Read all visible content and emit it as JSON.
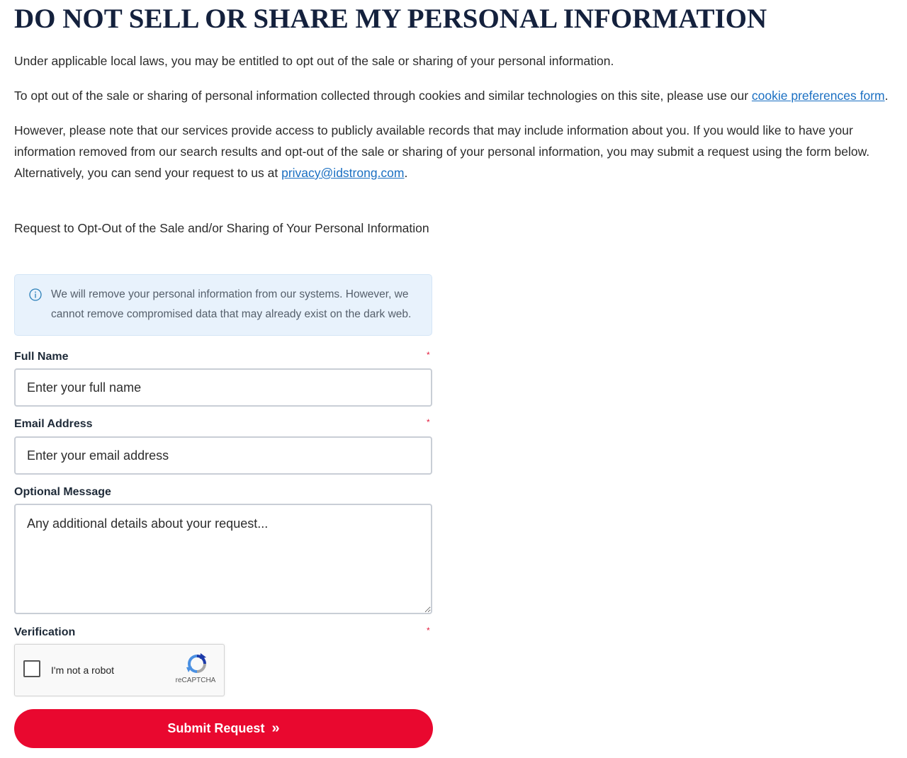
{
  "page": {
    "title": "DO NOT SELL OR SHARE MY PERSONAL INFORMATION",
    "intro": "Under applicable local laws, you may be entitled to opt out of the sale or sharing of your personal information.",
    "cookies_text": "To opt out of the sale or sharing of personal information collected through cookies and similar technologies on this site, please use our ",
    "cookies_link": "cookie preferences form",
    "cookies_end": ".",
    "records_text": "However, please note that our services provide access to publicly available records that may include information about you. If you would like to have your information removed from our search results and opt-out of the sale or sharing of your personal information, you may submit a request using the form below. Alternatively, you can send your request to us at ",
    "email_link": "privacy@idstrong.com",
    "records_end": "."
  },
  "form": {
    "heading": "Request to Opt-Out of the Sale and/or Sharing of Your Personal Information",
    "notice": "We will remove your personal information from our systems. However, we cannot remove compromised data that may already exist on the dark web.",
    "required_mark": "*",
    "full_name": {
      "label": "Full Name",
      "placeholder": "Enter your full name",
      "value": ""
    },
    "email": {
      "label": "Email Address",
      "placeholder": "Enter your email address",
      "value": ""
    },
    "message": {
      "label": "Optional Message",
      "placeholder": "Any additional details about your request...",
      "value": ""
    },
    "verification": {
      "label": "Verification",
      "checkbox_label": "I'm not a robot",
      "brand": "reCAPTCHA",
      "checked": false
    },
    "submit": {
      "label": "Submit Request",
      "icon": "double-chevron-right-icon",
      "chevron_glyph": "»"
    }
  },
  "colors": {
    "title": "#14213d",
    "link": "#1a6fc2",
    "notice_bg": "#e8f2fc",
    "required": "#e31c3d",
    "submit_bg": "#e9082f"
  }
}
